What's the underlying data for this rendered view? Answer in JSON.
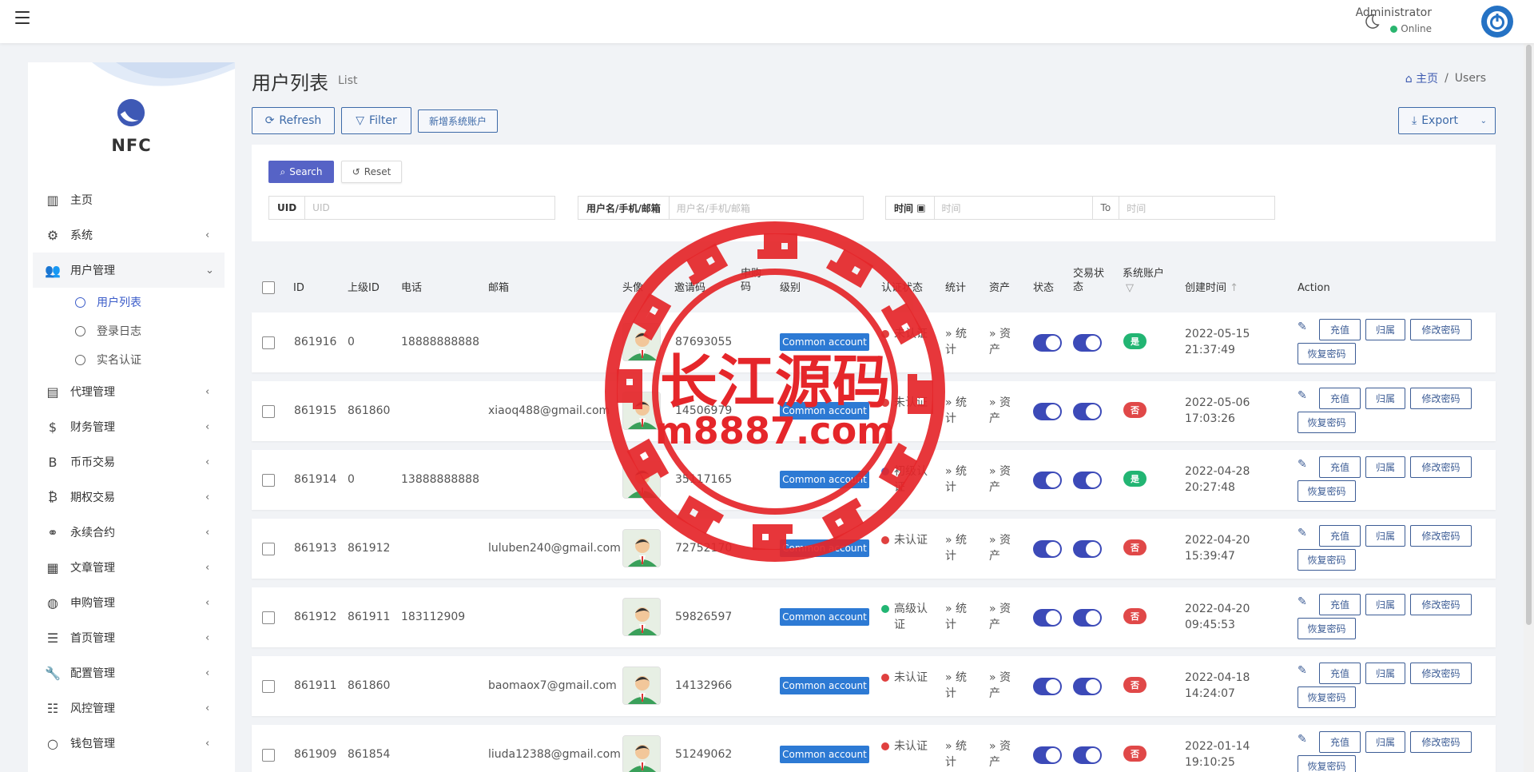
{
  "topbar": {
    "admin_name": "Administrator",
    "status": "Online"
  },
  "sidebar": {
    "brand": "NFC",
    "items": [
      {
        "label": "主页",
        "icon": "bar-chart-icon",
        "glyph": "▥",
        "chevron": false
      },
      {
        "label": "系统",
        "icon": "gear-icon",
        "glyph": "⚙",
        "chevron": true
      },
      {
        "label": "用户管理",
        "icon": "users-icon",
        "glyph": "👥",
        "open": true
      },
      {
        "label": "代理管理",
        "icon": "id-card-icon",
        "glyph": "▤",
        "chevron": true
      },
      {
        "label": "财务管理",
        "icon": "dollar-icon",
        "glyph": "$",
        "chevron": true
      },
      {
        "label": "币币交易",
        "icon": "bitcoin-b-icon",
        "glyph": "B",
        "chevron": true
      },
      {
        "label": "期权交易",
        "icon": "bitcoin-icon",
        "glyph": "₿",
        "chevron": true
      },
      {
        "label": "永续合约",
        "icon": "link-icon",
        "glyph": "⚭",
        "chevron": true
      },
      {
        "label": "文章管理",
        "icon": "newspaper-icon",
        "glyph": "▦",
        "chevron": true
      },
      {
        "label": "申购管理",
        "icon": "lifebuoy-icon",
        "glyph": "◍",
        "chevron": true
      },
      {
        "label": "首页管理",
        "icon": "list-icon",
        "glyph": "☰",
        "chevron": true
      },
      {
        "label": "配置管理",
        "icon": "wrench-icon",
        "glyph": "🔧",
        "chevron": true
      },
      {
        "label": "风控管理",
        "icon": "list-indent-icon",
        "glyph": "☷",
        "chevron": true
      },
      {
        "label": "钱包管理",
        "icon": "circle-icon",
        "glyph": "○",
        "chevron": true
      }
    ],
    "sub_items": [
      "用户列表",
      "登录日志",
      "实名认证"
    ]
  },
  "page": {
    "title": "用户列表",
    "subtitle": "List"
  },
  "breadcrumb": {
    "home": "主页",
    "sep": "/",
    "current": "Users"
  },
  "toolbar": {
    "refresh": "Refresh",
    "filter": "Filter",
    "add_account": "新增系统账户",
    "export": "Export"
  },
  "filter": {
    "search": "Search",
    "reset": "Reset",
    "uid_label": "UID",
    "uid_placeholder": "UID",
    "user_label": "用户名/手机/邮箱",
    "user_placeholder": "用户名/手机/邮箱",
    "time_label": "时间",
    "time_placeholder": "时间",
    "to_label": "To",
    "to_placeholder": "时间"
  },
  "table": {
    "headers": {
      "id": "ID",
      "parent": "上级ID",
      "phone": "电话",
      "email": "邮箱",
      "avatar": "头像",
      "invite": "邀请码",
      "apply": "申购码",
      "level": "级别",
      "auth": "认证状态",
      "stats": "统计",
      "assets": "资产",
      "status": "状态",
      "trade": "交易状态",
      "system": "系统账户",
      "created": "创建时间",
      "action": "Action"
    },
    "action_labels": {
      "recharge": "充值",
      "belong": "归属",
      "change_pwd": "修改密码",
      "reset_pwd": "恢复密码",
      "stats_link": "» 统计",
      "assets_link": "» 资产"
    },
    "rows": [
      {
        "id": "861916",
        "parent": "0",
        "phone": "18888888888",
        "email": "",
        "invite": "87693055",
        "level": "Common account",
        "auth": "未认证",
        "auth_color": "#e0403f",
        "system": "是",
        "system_color": "#22b573",
        "date": "2022-05-15",
        "time": "21:37:49"
      },
      {
        "id": "861915",
        "parent": "861860",
        "phone": "",
        "email": "xiaoq488@gmail.com",
        "invite": "14506979",
        "level": "Common account",
        "auth": "未认证",
        "auth_color": "#e0403f",
        "system": "否",
        "system_color": "#e04848",
        "date": "2022-05-06",
        "time": "17:03:26"
      },
      {
        "id": "861914",
        "parent": "0",
        "phone": "13888888888",
        "email": "",
        "invite": "35117165",
        "level": "Common account",
        "auth": "初级认证",
        "auth_color": "#3b6fd6",
        "system": "是",
        "system_color": "#22b573",
        "date": "2022-04-28",
        "time": "20:27:48"
      },
      {
        "id": "861913",
        "parent": "861912",
        "phone": "",
        "email": "luluben240@gmail.com",
        "invite": "72752170",
        "level": "Common account",
        "auth": "未认证",
        "auth_color": "#e0403f",
        "system": "否",
        "system_color": "#e04848",
        "date": "2022-04-20",
        "time": "15:39:47"
      },
      {
        "id": "861912",
        "parent": "861911",
        "phone": "183112909",
        "email": "",
        "invite": "59826597",
        "level": "Common account",
        "auth": "高级认证",
        "auth_color": "#22b573",
        "system": "否",
        "system_color": "#e04848",
        "date": "2022-04-20",
        "time": "09:45:53"
      },
      {
        "id": "861911",
        "parent": "861860",
        "phone": "",
        "email": "baomaox7@gmail.com",
        "invite": "14132966",
        "level": "Common account",
        "auth": "未认证",
        "auth_color": "#e0403f",
        "system": "否",
        "system_color": "#e04848",
        "date": "2022-04-18",
        "time": "14:24:07"
      },
      {
        "id": "861909",
        "parent": "861854",
        "phone": "",
        "email": "liuda12388@gmail.com",
        "invite": "51249062",
        "level": "Common account",
        "auth": "未认证",
        "auth_color": "#e0403f",
        "system": "否",
        "system_color": "#e04848",
        "date": "2022-01-14",
        "time": "19:10:25"
      }
    ]
  },
  "watermark": {
    "line1": "长江源码",
    "line2": "m8887.com",
    "color": "#e5262a"
  }
}
